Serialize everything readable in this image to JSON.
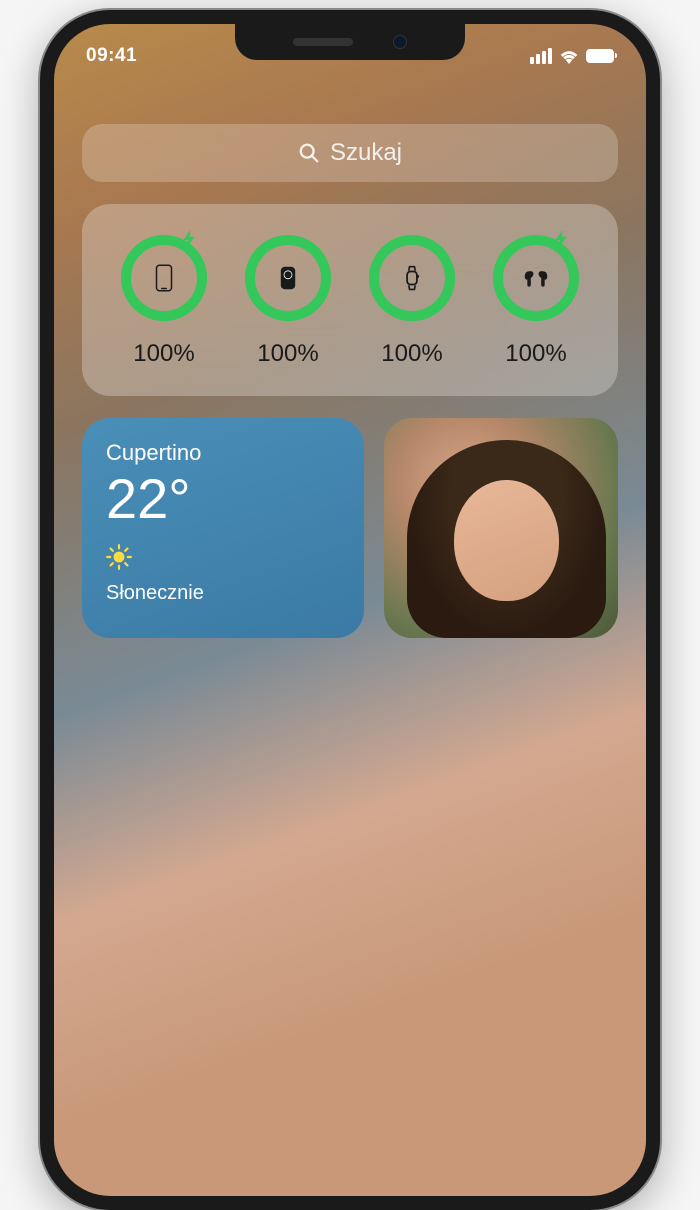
{
  "status": {
    "time": "09:41"
  },
  "search": {
    "placeholder": "Szukaj"
  },
  "batteries": {
    "ring_color": "#34c759",
    "devices": [
      {
        "name": "iphone",
        "percent": 100,
        "label": "100%",
        "charging": true
      },
      {
        "name": "magsafe-battery",
        "percent": 100,
        "label": "100%",
        "charging": false
      },
      {
        "name": "apple-watch",
        "percent": 100,
        "label": "100%",
        "charging": false
      },
      {
        "name": "airpods",
        "percent": 100,
        "label": "100%",
        "charging": true
      }
    ]
  },
  "weather": {
    "city": "Cupertino",
    "temp": "22°",
    "condition": "Słonecznie",
    "icon": "sun"
  }
}
